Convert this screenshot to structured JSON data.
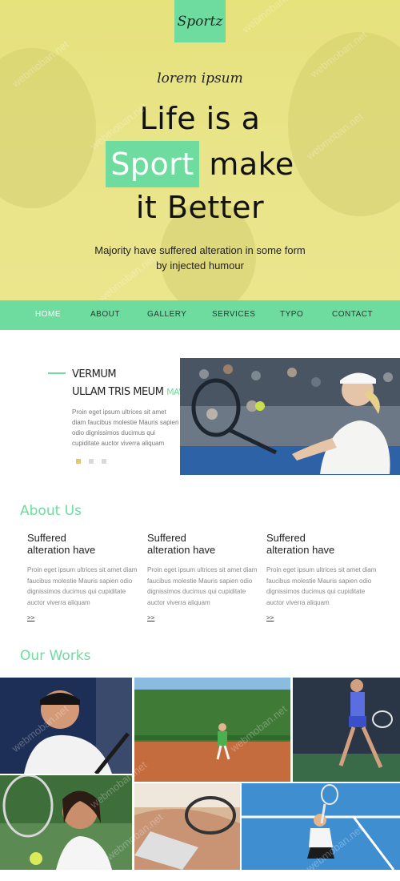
{
  "logo": {
    "text": "Sportz"
  },
  "hero": {
    "kicker": "lorem ipsum",
    "line1": "Life is a",
    "line2_highlight": "Sport",
    "line2_rest": " make",
    "line3": "it Better",
    "subtitle": "Majority have suffered alteration in some form by injected humour"
  },
  "nav": {
    "items": [
      {
        "label": "HOME",
        "active": true
      },
      {
        "label": "ABOUT",
        "active": false
      },
      {
        "label": "GALLERY",
        "active": false
      },
      {
        "label": "SERVICES",
        "active": false
      },
      {
        "label": "TYPO",
        "active": false
      },
      {
        "label": "CONTACT",
        "active": false
      }
    ]
  },
  "feature": {
    "title": "VERMUM",
    "sub_dark": "ULLAM TRIS",
    "sub_dark2": "MEUM",
    "sub_green": "MAVERE",
    "body": "Proin eget ipsum ultrices sit amet diam faucibus molestie Mauris sapien odio dignissimos ducimus qui cupiditate auctor viverra aliquam"
  },
  "about": {
    "title": "About Us",
    "columns": [
      {
        "heading_line1": "Suffered",
        "heading_line2": "alteration have",
        "body": "Proin eget ipsum ultrices sit amet diam faucibus molestie Mauris sapien odio dignissimos ducimus qui cupiditate auctor viverra aliquam",
        "more": ">>"
      },
      {
        "heading_line1": "Suffered",
        "heading_line2": "alteration have",
        "body": "Proin eget ipsum ultrices sit amet diam faucibus molestie Mauris sapien odio dignissimos ducimus qui cupiditate auctor viverra aliquam",
        "more": ">>"
      },
      {
        "heading_line1": "Suffered",
        "heading_line2": "alteration have",
        "body": "Proin eget ipsum ultrices sit amet diam faucibus molestie Mauris sapien odio dignissimos ducimus qui cupiditate auctor viverra aliquam",
        "more": ">>"
      }
    ]
  },
  "works": {
    "title": "Our Works"
  },
  "watermark": "webmoban.net",
  "colors": {
    "accent": "#6edc9e",
    "hero_bg": "#e8e384",
    "dot_active": "#e8c66a"
  }
}
